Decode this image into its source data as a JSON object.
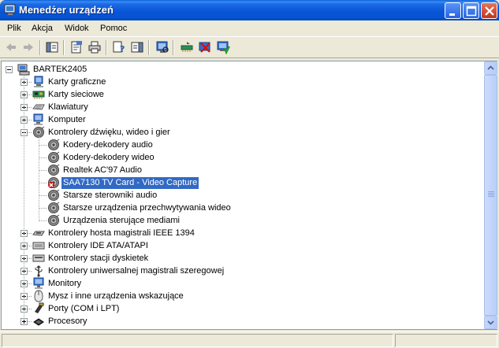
{
  "window": {
    "title": "Menedżer urządzeń",
    "buttons": {
      "minimize": "minimize",
      "maximize": "maximize",
      "close": "close"
    }
  },
  "menu": [
    "Plik",
    "Akcja",
    "Widok",
    "Pomoc"
  ],
  "toolbar": {
    "icons": [
      "back-arrow-icon",
      "forward-arrow-icon",
      "console-tree-icon",
      "properties-icon",
      "print-icon",
      "help-icon",
      "action-pane-icon",
      "scan-hardware-icon",
      "update-driver-icon",
      "uninstall-icon",
      "enable-device-icon"
    ]
  },
  "tree": {
    "root": "BARTEK2405",
    "items": [
      {
        "label": "Karty graficzne",
        "icon": "display-icon",
        "expanded": false
      },
      {
        "label": "Karty sieciowe",
        "icon": "network-card-icon",
        "expanded": false
      },
      {
        "label": "Klawiatury",
        "icon": "keyboard-icon",
        "expanded": false
      },
      {
        "label": "Komputer",
        "icon": "computer-icon",
        "expanded": false
      },
      {
        "label": "Kontrolery dźwięku, wideo i gier",
        "icon": "speaker-icon",
        "expanded": true,
        "children": [
          {
            "label": "Kodery-dekodery audio",
            "icon": "speaker-icon"
          },
          {
            "label": "Kodery-dekodery wideo",
            "icon": "speaker-icon"
          },
          {
            "label": "Realtek AC'97 Audio",
            "icon": "speaker-icon"
          },
          {
            "label": "SAA7130 TV Card - Video Capture",
            "icon": "disabled-speaker-icon",
            "selected": true
          },
          {
            "label": "Starsze sterowniki audio",
            "icon": "speaker-icon"
          },
          {
            "label": "Starsze urządzenia przechwytywania wideo",
            "icon": "speaker-icon"
          },
          {
            "label": "Urządzenia sterujące mediami",
            "icon": "speaker-icon"
          }
        ]
      },
      {
        "label": "Kontrolery hosta magistrali IEEE 1394",
        "icon": "controller-icon",
        "expanded": false
      },
      {
        "label": "Kontrolery IDE ATA/ATAPI",
        "icon": "ide-icon",
        "expanded": false
      },
      {
        "label": "Kontrolery stacji dyskietek",
        "icon": "floppy-controller-icon",
        "expanded": false
      },
      {
        "label": "Kontrolery uniwersalnej magistrali szeregowej",
        "icon": "usb-icon",
        "expanded": false
      },
      {
        "label": "Monitory",
        "icon": "monitor-icon",
        "expanded": false
      },
      {
        "label": "Mysz i inne urządzenia wskazujące",
        "icon": "mouse-icon",
        "expanded": false
      },
      {
        "label": "Porty (COM i LPT)",
        "icon": "port-icon",
        "expanded": false
      },
      {
        "label": "Procesory",
        "icon": "processor-icon",
        "expanded": false
      }
    ]
  },
  "colors": {
    "titlebar": "#0854D6",
    "selection": "#316AC5",
    "window_bg": "#ECE9D8"
  }
}
